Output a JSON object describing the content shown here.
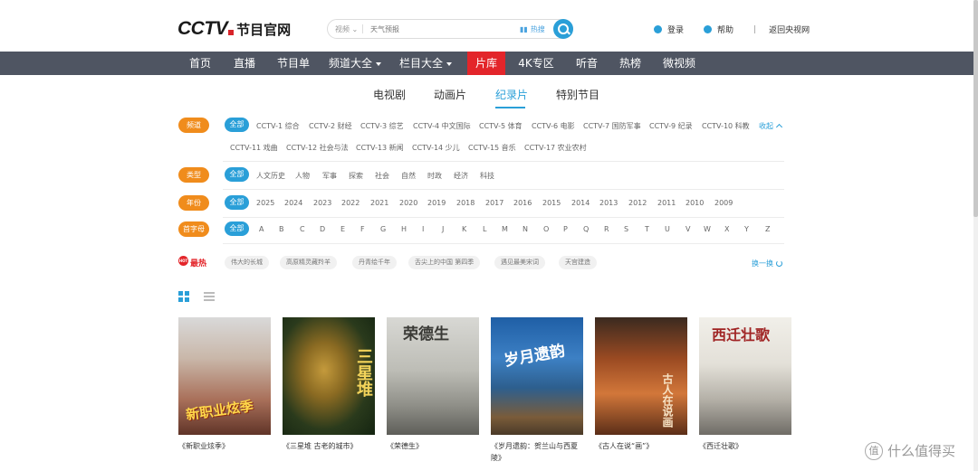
{
  "header": {
    "logo_text": "CCTV",
    "site_name": "节目官网",
    "search": {
      "type": "视频",
      "placeholder": "天气预报",
      "hot_label": "热搜"
    },
    "login": "登录",
    "help": "帮助",
    "back": "返回央视网"
  },
  "nav": [
    "首页",
    "直播",
    "节目单",
    "频道大全",
    "栏目大全",
    "片库",
    "4K专区",
    "听音",
    "热榜",
    "微视频"
  ],
  "subtabs": [
    "电视剧",
    "动画片",
    "纪录片",
    "特别节目"
  ],
  "filters": {
    "channel_label": "频道",
    "type_label": "类型",
    "year_label": "年份",
    "letter_label": "首字母",
    "all": "全部",
    "collapse": "收起",
    "channels_row1": [
      "CCTV-1 综合",
      "CCTV-2 财经",
      "CCTV-3 综艺",
      "CCTV-4 中文国际",
      "CCTV-5 体育",
      "CCTV-6 电影",
      "CCTV-7 国防军事",
      "CCTV-9 纪录",
      "CCTV-10 科教"
    ],
    "channels_row2": [
      "CCTV-11 戏曲",
      "CCTV-12 社会与法",
      "CCTV-13 新闻",
      "CCTV-14 少儿",
      "CCTV-15 音乐",
      "CCTV-17 农业农村"
    ],
    "types": [
      "人文历史",
      "人物",
      "军事",
      "探索",
      "社会",
      "自然",
      "时政",
      "经济",
      "科技"
    ],
    "years": [
      "2025",
      "2024",
      "2023",
      "2022",
      "2021",
      "2020",
      "2019",
      "2018",
      "2017",
      "2016",
      "2015",
      "2014",
      "2013",
      "2012",
      "2011",
      "2010",
      "2009"
    ],
    "letters": [
      "A",
      "B",
      "C",
      "D",
      "E",
      "F",
      "G",
      "H",
      "I",
      "J",
      "K",
      "L",
      "M",
      "N",
      "O",
      "P",
      "Q",
      "R",
      "S",
      "T",
      "U",
      "V",
      "W",
      "X",
      "Y",
      "Z"
    ]
  },
  "hot": {
    "badge": "HOT",
    "title": "最热",
    "tags": [
      "伟大的长城",
      "高原精灵藏羚羊",
      "丹青绘千年",
      "舌尖上的中国 第四季",
      "遇见最美宋词",
      "天宫建造"
    ],
    "refresh": "换一换"
  },
  "posters": [
    {
      "title": "《新职业炫季》",
      "art_text": "新职业炫季"
    },
    {
      "title": "《三星堆 古老的城市》",
      "art_text": "三星堆"
    },
    {
      "title": "《荣德生》",
      "art_text": "荣德生"
    },
    {
      "title": "《岁月遗韵：贺兰山与西夏陵》",
      "art_text": "岁月遗韵"
    },
    {
      "title": "《古人在说“画”》",
      "art_text": "古人在说画"
    },
    {
      "title": "《西迁壮歌》",
      "art_text": "西迁壮歌"
    }
  ],
  "watermark": "什么值得买"
}
